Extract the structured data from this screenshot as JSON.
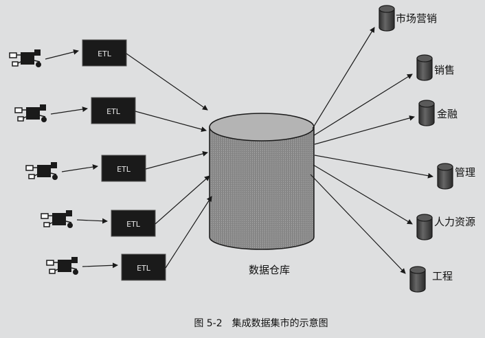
{
  "diagram": {
    "sources": [
      {
        "etl_label": "ETL"
      },
      {
        "etl_label": "ETL"
      },
      {
        "etl_label": "ETL"
      },
      {
        "etl_label": "ETL"
      },
      {
        "etl_label": "ETL"
      }
    ],
    "warehouse_label": "数据仓库",
    "marts": [
      {
        "label": "市场营销"
      },
      {
        "label": "销售"
      },
      {
        "label": "金融"
      },
      {
        "label": "管理"
      },
      {
        "label": "人力资源"
      },
      {
        "label": "工程"
      }
    ],
    "caption": "图 5-2　集成数据集市的示意图"
  },
  "colors": {
    "background": "#dedfe0",
    "etl_box": "#1a1a1a",
    "cylinder": "#8a8a8a",
    "line": "#1a1a1a"
  }
}
